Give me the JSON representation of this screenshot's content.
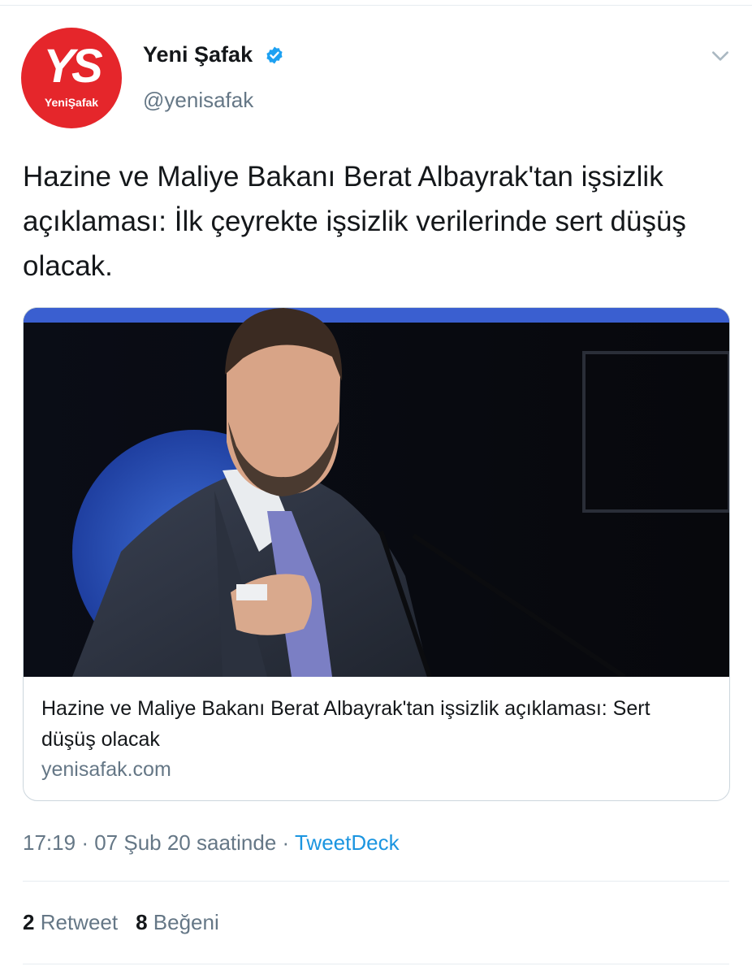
{
  "account": {
    "name": "Yeni Şafak",
    "handle": "@yenisafak",
    "avatar_monogram": "YS",
    "avatar_brand": "YeniŞafak",
    "verified_icon": "verified-badge-icon",
    "menu_icon": "chevron-down-icon"
  },
  "tweet": {
    "text": "Hazine ve Maliye Bakanı Berat Albayrak'tan işsizlik açıklaması: İlk çeyrekte işsizlik verilerinde sert düşüş olacak."
  },
  "card": {
    "title": "Hazine ve Maliye Bakanı Berat Albayrak'tan işsizlik açıklaması: Sert düşüş olacak",
    "domain": "yenisafak.com"
  },
  "meta": {
    "time": "17:19",
    "sep": "·",
    "date": "07 Şub 20 saatinde",
    "source": "TweetDeck"
  },
  "stats": {
    "retweets": "2",
    "retweets_label": "Retweet",
    "likes": "8",
    "likes_label": "Beğeni"
  },
  "colors": {
    "brand_red": "#e5262b",
    "link_blue": "#1b95e0",
    "secondary_text": "#657786",
    "verified_blue": "#1da1f2"
  }
}
